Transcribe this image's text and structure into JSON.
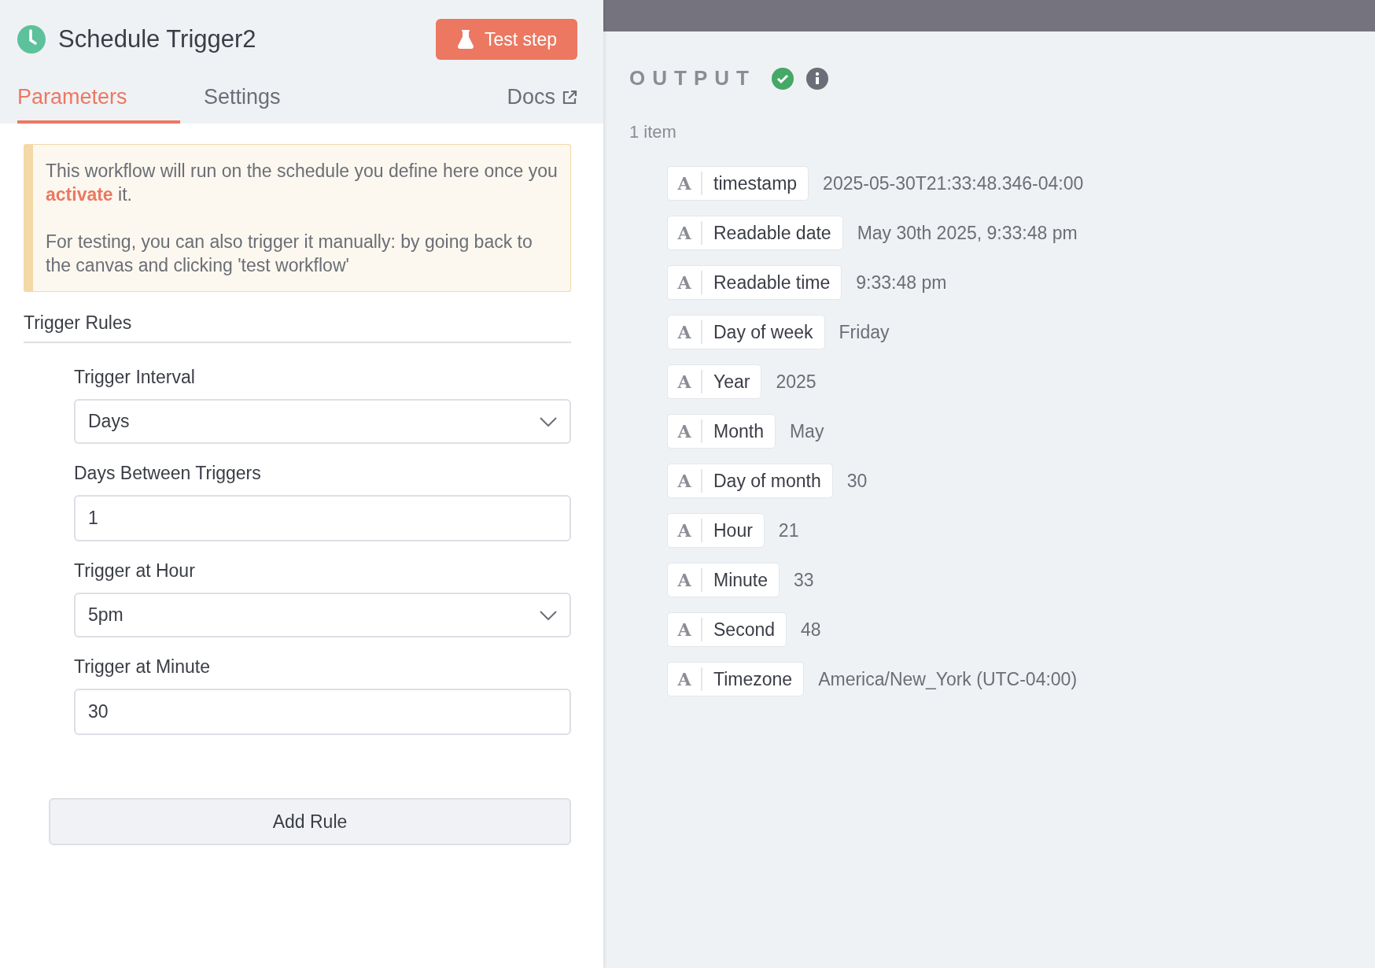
{
  "node": {
    "title": "Schedule Trigger2",
    "test_button": "Test step"
  },
  "tabs": [
    {
      "label": "Parameters",
      "selected": true
    },
    {
      "label": "Settings",
      "selected": false
    }
  ],
  "docs_link": "Docs",
  "notice": {
    "paragraphs": [
      "This workflow will run on the schedule you define here once you **activate** it.",
      "For testing, you can also trigger it manually: by going back to the canvas and clicking 'test workflow'"
    ]
  },
  "section_title": "Trigger Rules",
  "fields": [
    {
      "kind": "select",
      "label": "Trigger Interval",
      "value": "Days"
    },
    {
      "kind": "input",
      "label": "Days Between Triggers",
      "value": "1"
    },
    {
      "kind": "select",
      "label": "Trigger at Hour",
      "value": "5pm"
    },
    {
      "kind": "input",
      "label": "Trigger at Minute",
      "value": "30"
    }
  ],
  "add_rule_button": "Add Rule",
  "output": {
    "title": "OUTPUT",
    "success": true,
    "count": "1 item",
    "rows": [
      {
        "type": "A",
        "key": "timestamp",
        "value": "2025-05-30T21:33:48.346-04:00"
      },
      {
        "type": "A",
        "key": "Readable date",
        "value": "May 30th 2025, 9:33:48 pm"
      },
      {
        "type": "A",
        "key": "Readable time",
        "value": "9:33:48 pm"
      },
      {
        "type": "A",
        "key": "Day of week",
        "value": "Friday"
      },
      {
        "type": "A",
        "key": "Year",
        "value": "2025"
      },
      {
        "type": "A",
        "key": "Month",
        "value": "May"
      },
      {
        "type": "A",
        "key": "Day of month",
        "value": "30"
      },
      {
        "type": "A",
        "key": "Hour",
        "value": "21"
      },
      {
        "type": "A",
        "key": "Minute",
        "value": "33"
      },
      {
        "type": "A",
        "key": "Second",
        "value": "48"
      },
      {
        "type": "A",
        "key": "Timezone",
        "value": "America/New_York (UTC-04:00)"
      }
    ]
  }
}
